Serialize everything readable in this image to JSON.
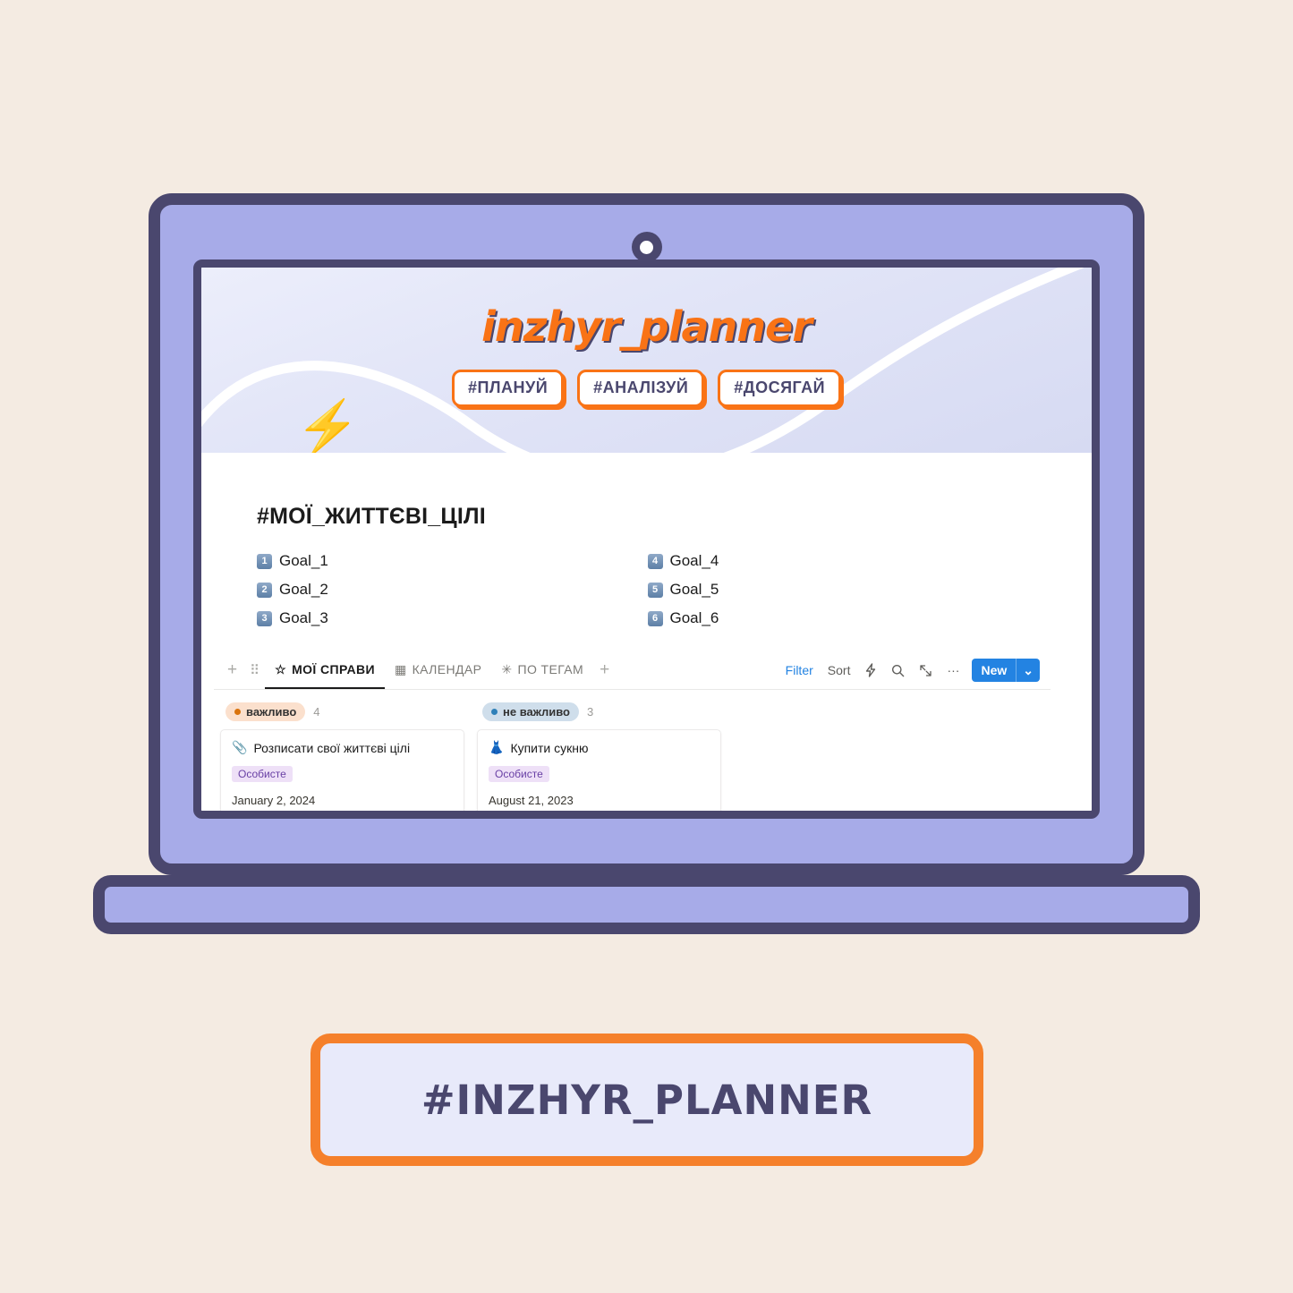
{
  "device": {
    "type": "laptop-mockup",
    "frame_color": "#4a476e",
    "body_color": "#a7abe8",
    "page_background": "#f4ebe2"
  },
  "banner": {
    "title": "inzhyr_planner",
    "title_color": "#f97316",
    "accent_color": "#f97316",
    "bolt_icon": "⚡",
    "pills": [
      {
        "label": "#ПЛАНУЙ"
      },
      {
        "label": "#АНАЛІЗУЙ"
      },
      {
        "label": "#ДОСЯГАЙ"
      }
    ]
  },
  "page": {
    "heading": "#МОЇ_ЖИТТЄВІ_ЦІЛІ",
    "goals": [
      {
        "num": "1",
        "label": "Goal_1"
      },
      {
        "num": "4",
        "label": "Goal_4"
      },
      {
        "num": "2",
        "label": "Goal_2"
      },
      {
        "num": "5",
        "label": "Goal_5"
      },
      {
        "num": "3",
        "label": "Goal_3"
      },
      {
        "num": "6",
        "label": "Goal_6"
      }
    ]
  },
  "toolbar": {
    "add_view_label": "+",
    "grip_label": "⠿",
    "tabs": [
      {
        "label": "МОЇ СПРАВИ",
        "icon": "☆",
        "icon_name": "star-icon",
        "active": true
      },
      {
        "label": "КАЛЕНДАР",
        "icon": "▦",
        "icon_name": "calendar-icon",
        "active": false
      },
      {
        "label": "ПО ТЕГАМ",
        "icon": "✳",
        "icon_name": "asterisk-icon",
        "active": false
      }
    ],
    "add_tab_label": "+",
    "filter_label": "Filter",
    "filter_color": "#2383e2",
    "sort_label": "Sort",
    "lightning_icon": "⚡",
    "search_icon": "search-icon",
    "expand_icon": "collapse-arrows-icon",
    "more_icon": "···",
    "new_label": "New",
    "new_chevron": "⌄",
    "new_button_color": "#2383e2"
  },
  "board": {
    "columns": [
      {
        "title": "важливо",
        "count": "4",
        "chip_bg": "#fbe0cd",
        "dot_color": "#d9730d",
        "cards": [
          {
            "icon": "📎",
            "icon_name": "paperclip-icon",
            "title": "Розписати свої життєві цілі",
            "tag": "Особисте",
            "date": "January 2, 2024"
          }
        ]
      },
      {
        "title": "не важливо",
        "count": "3",
        "chip_bg": "#cfdeeb",
        "dot_color": "#2f80b8",
        "cards": [
          {
            "icon": "👗",
            "icon_name": "dress-icon",
            "title": "Купити сукню",
            "tag": "Особисте",
            "date": "August 21, 2023"
          }
        ]
      }
    ]
  },
  "bottom_banner": {
    "label": "#INZHYR_PLANNER",
    "border_color": "#f5802b",
    "fill_color": "#e8eafa",
    "text_color": "#4a476e"
  }
}
